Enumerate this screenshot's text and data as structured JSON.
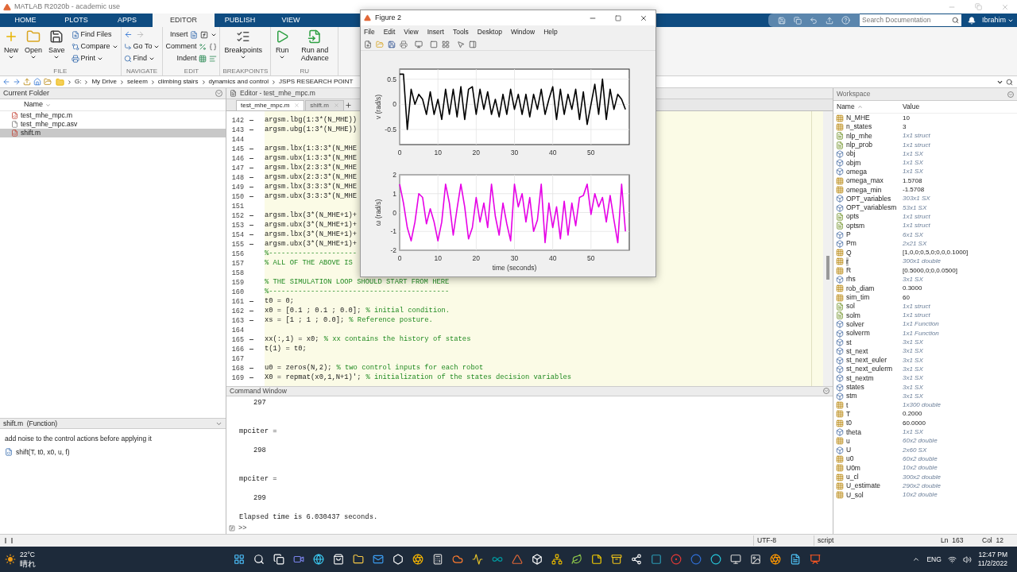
{
  "window": {
    "title": "MATLAB R2020b - academic use"
  },
  "tabs": [
    {
      "label": "HOME",
      "selected": false
    },
    {
      "label": "PLOTS",
      "selected": false
    },
    {
      "label": "APPS",
      "selected": false
    },
    {
      "label": "EDITOR",
      "selected": true
    },
    {
      "label": "PUBLISH",
      "selected": false
    },
    {
      "label": "VIEW",
      "selected": false
    }
  ],
  "search": {
    "placeholder": "Search Documentation"
  },
  "user": {
    "name": "Ibrahim"
  },
  "ribbon": {
    "groups": [
      {
        "kind": "file",
        "label": "FILE",
        "large": [
          {
            "label": "New",
            "menu": true
          },
          {
            "label": "Open",
            "menu": true
          },
          {
            "label": "Save",
            "menu": true
          }
        ],
        "small": [
          {
            "label": "Find Files",
            "menu": false
          },
          {
            "label": "Compare",
            "menu": true
          },
          {
            "label": "Print",
            "menu": true
          }
        ]
      },
      {
        "kind": "navigate",
        "label": "NAVIGATE",
        "small": [
          {
            "label": "Go To",
            "menu": true
          },
          {
            "label": "Find",
            "menu": true
          }
        ]
      },
      {
        "kind": "edit",
        "label": "EDIT",
        "small": [
          {
            "label": "Insert",
            "menu": true
          },
          {
            "label": "Comment",
            "menu": false
          },
          {
            "label": "Indent",
            "menu": false
          }
        ]
      },
      {
        "kind": "breakpoints",
        "label": "BREAKPOINTS",
        "large": [
          {
            "label": "Breakpoints",
            "menu": true
          }
        ]
      },
      {
        "kind": "run",
        "label": "RU",
        "large": [
          {
            "label": "Run",
            "menu": true
          },
          {
            "label": "Run and Advance",
            "menu": false
          }
        ]
      }
    ]
  },
  "address": {
    "path": [
      "G:",
      "My Drive",
      "seleem",
      "climbing stairs",
      "dynamics and control",
      "JSPS RESEARCH POINT"
    ]
  },
  "current_folder": {
    "title": "Current Folder",
    "column": "Name",
    "files": [
      {
        "name": "test_mhe_mpc.m",
        "kind": "script",
        "selected": false
      },
      {
        "name": "test_mhe_mpc.asv",
        "kind": "document",
        "selected": false
      },
      {
        "name": "shift.m",
        "kind": "script",
        "selected": true
      }
    ]
  },
  "details": {
    "title": "shift.m  (Function)",
    "description": "add noise to the control actions before applying it",
    "signature": "shift(T, t0, x0, u, f)"
  },
  "editor": {
    "title": "Editor - test_mhe_mpc.m",
    "tabs": [
      {
        "label": "test_mhe_mpc.m",
        "selected": true
      },
      {
        "label": "shift.m",
        "selected": false
      }
    ],
    "lines": [
      {
        "number": "142",
        "executable": true,
        "code": "argsm.lbg(1:3*(N_MHE))"
      },
      {
        "number": "143",
        "executable": true,
        "code": "argsm.ubg(1:3*(N_MHE))"
      },
      {
        "number": "144",
        "executable": false
      },
      {
        "number": "145",
        "executable": true,
        "code": "argsm.lbx(1:3:3*(N_MHE"
      },
      {
        "number": "146",
        "executable": true,
        "code": "argsm.ubx(1:3:3*(N_MHE"
      },
      {
        "number": "147",
        "executable": true,
        "code": "argsm.lbx(2:3:3*(N_MHE"
      },
      {
        "number": "148",
        "executable": true,
        "code": "argsm.ubx(2:3:3*(N_MHE"
      },
      {
        "number": "149",
        "executable": true,
        "code": "argsm.lbx(3:3:3*(N_MHE"
      },
      {
        "number": "150",
        "executable": true,
        "code": "argsm.ubx(3:3:3*(N_MHE"
      },
      {
        "number": "151",
        "executable": false
      },
      {
        "number": "152",
        "executable": true,
        "code": "argsm.lbx(3*(N_MHE+1)+"
      },
      {
        "number": "153",
        "executable": true,
        "code": "argsm.ubx(3*(N_MHE+1)+"
      },
      {
        "number": "154",
        "executable": true,
        "code": "argsm.lbx(3*(N_MHE+1)+"
      },
      {
        "number": "155",
        "executable": true,
        "code": "argsm.ubx(3*(N_MHE+1)+"
      },
      {
        "number": "156",
        "executable": false,
        "comment": "%---------------------"
      },
      {
        "number": "157",
        "executable": false,
        "comment": "% ALL OF THE ABOVE IS"
      },
      {
        "number": "158",
        "executable": false
      },
      {
        "number": "159",
        "executable": false,
        "comment": "% THE SIMULATION LOOP SHOULD START FROM HERE"
      },
      {
        "number": "160",
        "executable": false,
        "comment": "%-------------------------------------------"
      },
      {
        "number": "161",
        "executable": true,
        "code": "t0 = 0;"
      },
      {
        "number": "162",
        "executable": true,
        "code": "x0 = [0.1 ; 0.1 ; 0.0];",
        "comment": "% initial condition."
      },
      {
        "number": "163",
        "executable": true,
        "code": "xs = [1 ; 1 ; 0.0];",
        "comment": "% Reference posture."
      },
      {
        "number": "164",
        "executable": false
      },
      {
        "number": "165",
        "executable": true,
        "code": "xx(:,1) = x0;",
        "comment": "% xx contains the history of states"
      },
      {
        "number": "166",
        "executable": true,
        "code": "t(1) = t0;"
      },
      {
        "number": "167",
        "executable": false
      },
      {
        "number": "168",
        "executable": true,
        "code": "u0 = zeros(N,2);",
        "comment": "% two control inputs for each robot"
      },
      {
        "number": "169",
        "executable": true,
        "code": "X0 = repmat(x0,1,N+1)';",
        "comment": "% initialization of the states decision variables"
      }
    ]
  },
  "command_window": {
    "title": "Command Window",
    "lines": [
      {
        "kind": "value",
        "text": "297"
      },
      {
        "kind": "variable",
        "text": "mpciter ="
      },
      {
        "kind": "value",
        "text": "298"
      },
      {
        "kind": "variable",
        "text": "mpciter ="
      },
      {
        "kind": "value",
        "text": "299"
      },
      {
        "kind": "message",
        "text": "Elapsed time is 6.030437 seconds."
      }
    ],
    "prompt": ">>"
  },
  "workspace": {
    "title": "Workspace",
    "columns": [
      "Name",
      "Value"
    ],
    "rows": [
      {
        "name": "N_MHE",
        "value": "10",
        "kind": "numeric",
        "summary": false,
        "selected": false
      },
      {
        "name": "n_states",
        "value": "3",
        "kind": "numeric",
        "summary": false,
        "selected": false
      },
      {
        "name": "nlp_mhe",
        "value": "1x1 struct",
        "kind": "struct",
        "summary": true,
        "selected": false
      },
      {
        "name": "nlp_prob",
        "value": "1x1 struct",
        "kind": "struct",
        "summary": true,
        "selected": false
      },
      {
        "name": "obj",
        "value": "1x1 SX",
        "kind": "object",
        "summary": true,
        "selected": false
      },
      {
        "name": "objm",
        "value": "1x1 SX",
        "kind": "object",
        "summary": true,
        "selected": false
      },
      {
        "name": "omega",
        "value": "1x1 SX",
        "kind": "object",
        "summary": true,
        "selected": false
      },
      {
        "name": "omega_max",
        "value": "1.5708",
        "kind": "numeric",
        "summary": false,
        "selected": false
      },
      {
        "name": "omega_min",
        "value": "-1.5708",
        "kind": "numeric",
        "summary": false,
        "selected": false
      },
      {
        "name": "OPT_variables",
        "value": "303x1 SX",
        "kind": "object",
        "summary": true,
        "selected": false
      },
      {
        "name": "OPT_variablesm",
        "value": "53x1 SX",
        "kind": "object",
        "summary": true,
        "selected": false
      },
      {
        "name": "opts",
        "value": "1x1 struct",
        "kind": "struct",
        "summary": true,
        "selected": false
      },
      {
        "name": "optsm",
        "value": "1x1 struct",
        "kind": "struct",
        "summary": true,
        "selected": false
      },
      {
        "name": "P",
        "value": "6x1 SX",
        "kind": "object",
        "summary": true,
        "selected": false
      },
      {
        "name": "Pm",
        "value": "2x21 SX",
        "kind": "object",
        "summary": true,
        "selected": false
      },
      {
        "name": "Q",
        "value": "[1,0,0;0,5,0;0,0,0.1000]",
        "kind": "numeric",
        "summary": false,
        "selected": false
      },
      {
        "name": "r",
        "value": "300x1 double",
        "kind": "numeric",
        "summary": true,
        "selected": true
      },
      {
        "name": "R",
        "value": "[0.5000,0;0,0.0500]",
        "kind": "numeric",
        "summary": false,
        "selected": false
      },
      {
        "name": "rhs",
        "value": "3x1 SX",
        "kind": "object",
        "summary": true,
        "selected": false
      },
      {
        "name": "rob_diam",
        "value": "0.3000",
        "kind": "numeric",
        "summary": false,
        "selected": false
      },
      {
        "name": "sim_tim",
        "value": "60",
        "kind": "numeric",
        "summary": false,
        "selected": false
      },
      {
        "name": "sol",
        "value": "1x1 struct",
        "kind": "struct",
        "summary": true,
        "selected": false
      },
      {
        "name": "solm",
        "value": "1x1 struct",
        "kind": "struct",
        "summary": true,
        "selected": false
      },
      {
        "name": "solver",
        "value": "1x1 Function",
        "kind": "object",
        "summary": true,
        "selected": false
      },
      {
        "name": "solverm",
        "value": "1x1 Function",
        "kind": "object",
        "summary": true,
        "selected": false
      },
      {
        "name": "st",
        "value": "3x1 SX",
        "kind": "object",
        "summary": true,
        "selected": false
      },
      {
        "name": "st_next",
        "value": "3x1 SX",
        "kind": "object",
        "summary": true,
        "selected": false
      },
      {
        "name": "st_next_euler",
        "value": "3x1 SX",
        "kind": "object",
        "summary": true,
        "selected": false
      },
      {
        "name": "st_next_eulerm",
        "value": "3x1 SX",
        "kind": "object",
        "summary": true,
        "selected": false
      },
      {
        "name": "st_nextm",
        "value": "3x1 SX",
        "kind": "object",
        "summary": true,
        "selected": false
      },
      {
        "name": "states",
        "value": "3x1 SX",
        "kind": "object",
        "summary": true,
        "selected": false
      },
      {
        "name": "stm",
        "value": "3x1 SX",
        "kind": "object",
        "summary": true,
        "selected": false
      },
      {
        "name": "t",
        "value": "1x300 double",
        "kind": "numeric",
        "summary": true,
        "selected": false
      },
      {
        "name": "T",
        "value": "0.2000",
        "kind": "numeric",
        "summary": false,
        "selected": false
      },
      {
        "name": "t0",
        "value": "60.0000",
        "kind": "numeric",
        "summary": false,
        "selected": false
      },
      {
        "name": "theta",
        "value": "1x1 SX",
        "kind": "object",
        "summary": true,
        "selected": false
      },
      {
        "name": "u",
        "value": "60x2 double",
        "kind": "numeric",
        "summary": true,
        "selected": false
      },
      {
        "name": "U",
        "value": "2x60 SX",
        "kind": "object",
        "summary": true,
        "selected": false
      },
      {
        "name": "u0",
        "value": "60x2 double",
        "kind": "numeric",
        "summary": true,
        "selected": false
      },
      {
        "name": "U0m",
        "value": "10x2 double",
        "kind": "numeric",
        "summary": true,
        "selected": false
      },
      {
        "name": "u_cl",
        "value": "300x2 double",
        "kind": "numeric",
        "summary": true,
        "selected": false
      },
      {
        "name": "U_estimate",
        "value": "290x2 double",
        "kind": "numeric",
        "summary": true,
        "selected": false
      },
      {
        "name": "U_sol",
        "value": "10x2 double",
        "kind": "numeric",
        "summary": true,
        "selected": false
      }
    ]
  },
  "status_bar": {
    "encoding": "UTF-8",
    "file_type": "script",
    "line": "Ln  163",
    "column": "Col  12"
  },
  "figure": {
    "title": "Figure 2",
    "menu": [
      "File",
      "Edit",
      "View",
      "Insert",
      "Tools",
      "Desktop",
      "Window",
      "Help"
    ],
    "charts": [
      {
        "chart_data": {
          "type": "line",
          "grid": true,
          "ylabel": "v (rad/s)",
          "xlim": [
            0,
            60
          ],
          "ylim": [
            -0.8,
            0.7
          ],
          "xticks": [
            0,
            10,
            20,
            30,
            40,
            50
          ],
          "yticks": [
            -0.5,
            0,
            0.5
          ],
          "x": [
            0,
            1,
            2,
            3,
            4,
            5,
            6,
            7,
            8,
            9,
            10,
            11,
            12,
            13,
            14,
            15,
            16,
            17,
            18,
            19,
            20,
            21,
            22,
            23,
            24,
            25,
            26,
            27,
            28,
            29,
            30,
            31,
            32,
            33,
            34,
            35,
            36,
            37,
            38,
            39,
            40,
            41,
            42,
            43,
            44,
            45,
            46,
            47,
            48,
            49,
            50,
            51,
            52,
            53,
            54,
            55,
            56,
            57,
            58,
            59
          ],
          "series": [
            {
              "color": "#000000",
              "values": [
                0.6,
                0.6,
                -0.5,
                0.3,
                0.0,
                0.2,
                0.1,
                -0.2,
                0.25,
                -0.2,
                0.1,
                -0.3,
                0.3,
                -0.2,
                0.3,
                -0.25,
                0.35,
                -0.3,
                0.3,
                0.35,
                -0.2,
                0.3,
                -0.1,
                0.25,
                -0.2,
                0.1,
                -0.25,
                0.2,
                -0.2,
                0.3,
                -0.1,
                0.2,
                -0.2,
                0.2,
                -0.25,
                0.2,
                -0.1,
                0.3,
                -0.2,
                0.1,
                0.35,
                -0.3,
                0.3,
                -0.2,
                0.2,
                -0.1,
                0.3,
                -0.3,
                0.25,
                -0.4,
                0.0,
                0.4,
                -0.2,
                0.5,
                -0.3,
                0.3,
                -0.1,
                0.2,
                0.1,
                -0.1
              ]
            }
          ]
        }
      },
      {
        "chart_data": {
          "type": "line",
          "grid": true,
          "xlabel": "time (seconds)",
          "ylabel": "ω (rad/s)",
          "xlim": [
            0,
            60
          ],
          "ylim": [
            -2,
            2
          ],
          "xticks": [
            0,
            10,
            20,
            30,
            40,
            50
          ],
          "yticks": [
            -2,
            -1,
            0,
            1,
            2
          ],
          "x": [
            0,
            1,
            2,
            3,
            4,
            5,
            6,
            7,
            8,
            9,
            10,
            11,
            12,
            13,
            14,
            15,
            16,
            17,
            18,
            19,
            20,
            21,
            22,
            23,
            24,
            25,
            26,
            27,
            28,
            29,
            30,
            31,
            32,
            33,
            34,
            35,
            36,
            37,
            38,
            39,
            40,
            41,
            42,
            43,
            44,
            45,
            46,
            47,
            48,
            49,
            50,
            51,
            52,
            53,
            54,
            55,
            56,
            57,
            58,
            59
          ],
          "series": [
            {
              "color": "#e600e6",
              "values": [
                1.5,
                0.5,
                -0.8,
                -1.5,
                -0.5,
                1.0,
                0.8,
                -0.6,
                0.2,
                -0.5,
                -1.5,
                -0.5,
                1.5,
                0.5,
                -1.2,
                0.2,
                1.5,
                0.3,
                -1.4,
                -0.8,
                0.8,
                -0.5,
                0.5,
                -0.8,
                1.5,
                -0.2,
                -1.2,
                0.5,
                -0.6,
                -1.5,
                1.5,
                0.3,
                1.0,
                -0.5,
                0.8,
                -1.0,
                -0.4,
                1.5,
                -1.6,
                0.5,
                -0.8,
                0.3,
                -1.4,
                0.6,
                -1.2,
                0.5,
                -0.7,
                0.8,
                0.9,
                1.5,
                -0.1,
                1.0,
                0.3,
                0.8,
                -0.5,
                0.9,
                -0.4,
                -1.6,
                1.5,
                -1.0
              ]
            }
          ]
        }
      }
    ]
  },
  "taskbar": {
    "temperature": "22°C",
    "weather": "晴れ",
    "language": "ENG",
    "time": "12:47 PM",
    "date": "11/2/2022"
  }
}
